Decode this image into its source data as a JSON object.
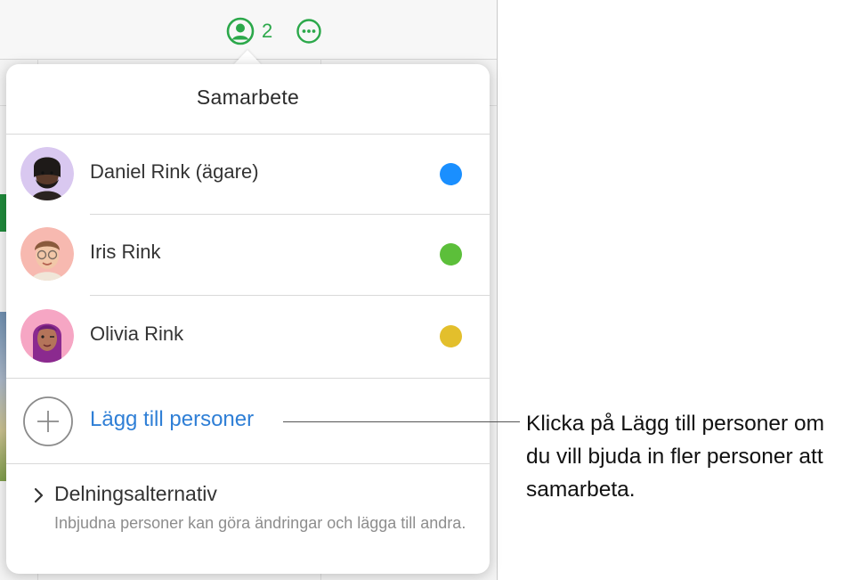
{
  "toolbar": {
    "collaborators_count": "2",
    "collaborate_icon": "person-circle-icon",
    "more_icon": "ellipsis-circle-icon",
    "accent_color": "#2ba84a"
  },
  "popover": {
    "title": "Samarbete",
    "participants": [
      {
        "name": "Daniel Rink (ägare)",
        "color": "#1a8fff",
        "avatar": "memoji-daniel"
      },
      {
        "name": "Iris Rink",
        "color": "#5cbf3a",
        "avatar": "memoji-iris"
      },
      {
        "name": "Olivia Rink",
        "color": "#e3bf2c",
        "avatar": "memoji-olivia"
      }
    ],
    "add_people_label": "Lägg till personer",
    "share_options": {
      "title": "Delningsalternativ",
      "description": "Inbjudna personer kan göra ändringar och lägga till andra."
    }
  },
  "callout": {
    "text": "Klicka på Lägg till personer om du vill bjuda in fler personer att samarbeta."
  }
}
